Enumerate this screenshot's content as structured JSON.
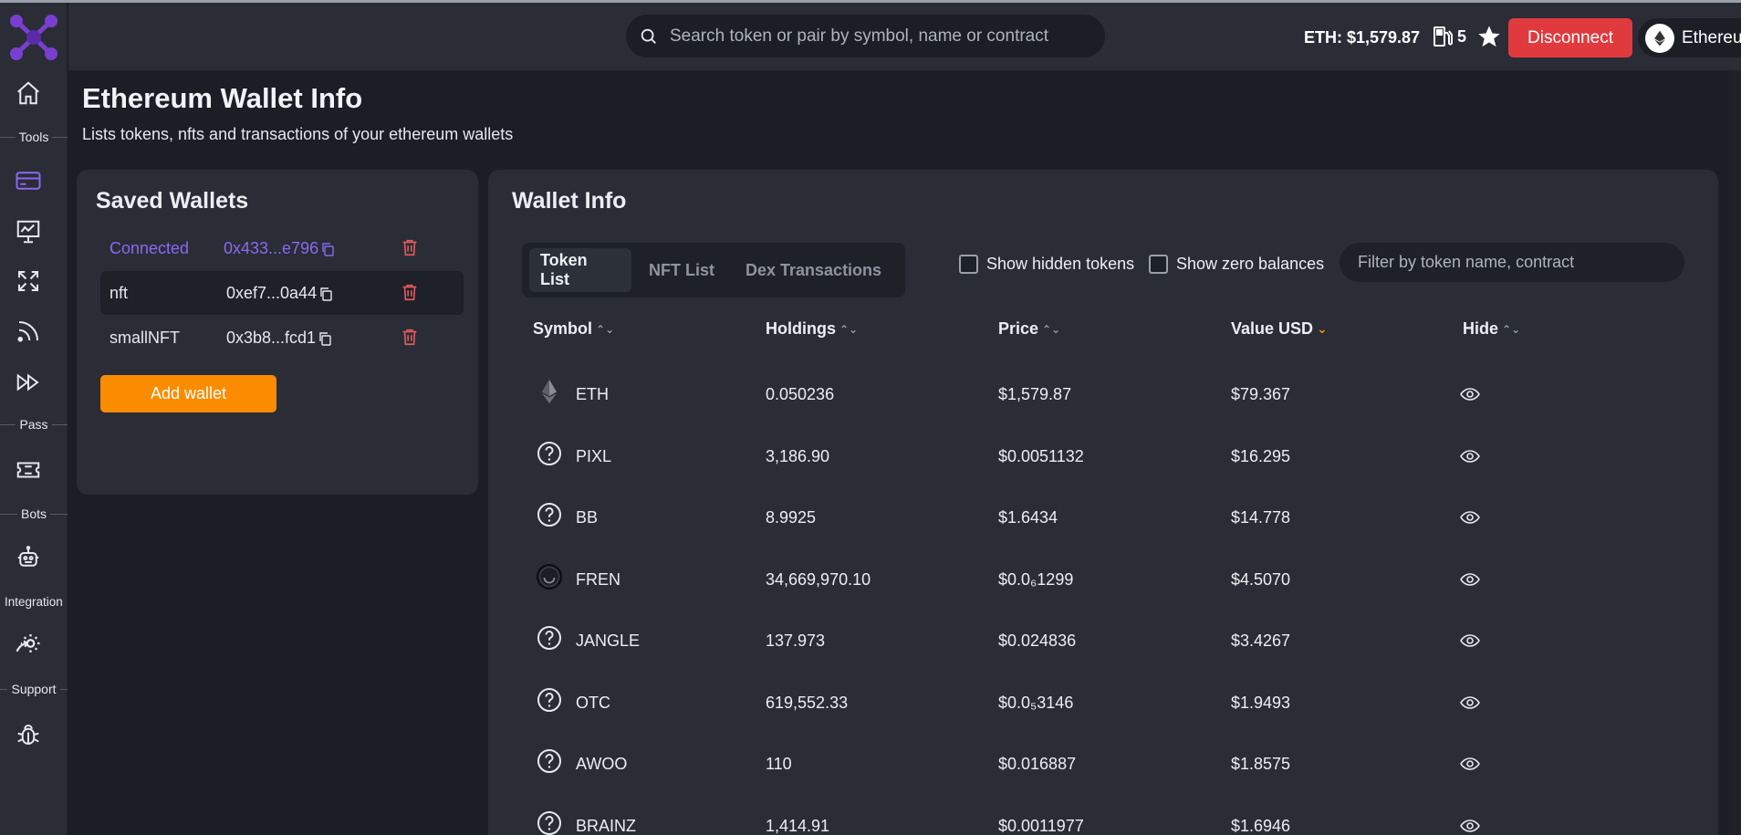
{
  "header": {
    "search_placeholder": "Search token or pair by symbol, name or contract",
    "eth_price": "ETH: $1,579.87",
    "gas": "5",
    "disconnect_label": "Disconnect",
    "network": "Ethereum"
  },
  "sidebar": {
    "sections": {
      "tools": "Tools",
      "pass": "Pass",
      "bots": "Bots",
      "integration": "Integration",
      "support": "Support"
    },
    "icons": [
      "home-icon",
      "wallet-card-icon",
      "presentation-icon",
      "expand-icon",
      "rss-icon",
      "fast-forward-icon",
      "ticket-icon",
      "robot-icon",
      "gear-integration-icon",
      "bug-icon"
    ]
  },
  "page": {
    "title": "Ethereum Wallet Info",
    "subtitle": "Lists tokens, nfts and transactions of your ethereum wallets"
  },
  "saved_wallets": {
    "title": "Saved Wallets",
    "wallets": [
      {
        "name": "Connected",
        "address": "0x433...e796"
      },
      {
        "name": "nft",
        "address": "0xef7...0a44"
      },
      {
        "name": "smallNFT",
        "address": "0x3b8...fcd1"
      }
    ],
    "add_label": "Add wallet"
  },
  "wallet_info": {
    "title": "Wallet Info",
    "tabs": [
      "Token List",
      "NFT List",
      "Dex Transactions"
    ],
    "show_hidden": "Show hidden tokens",
    "show_zero": "Show zero balances",
    "filter_placeholder": "Filter by token name, contract",
    "columns": [
      "Symbol",
      "Holdings",
      "Price",
      "Value USD",
      "Hide"
    ],
    "rows": [
      {
        "symbol": "ETH",
        "holdings": "0.050236",
        "price": "$1,579.87",
        "value": "$79.367",
        "icon": "eth-icon"
      },
      {
        "symbol": "PIXL",
        "holdings": "3,186.90",
        "price": "$0.0051132",
        "value": "$16.295",
        "icon": "question-icon"
      },
      {
        "symbol": "BB",
        "holdings": "8.9925",
        "price": "$1.6434",
        "value": "$14.778",
        "icon": "question-icon"
      },
      {
        "symbol": "FREN",
        "holdings": "34,669,970.10",
        "price": "$0.0₆1299",
        "value": "$4.5070",
        "icon": "smiley-icon"
      },
      {
        "symbol": "JANGLE",
        "holdings": "137.973",
        "price": "$0.024836",
        "value": "$3.4267",
        "icon": "question-icon"
      },
      {
        "symbol": "OTC",
        "holdings": "619,552.33",
        "price": "$0.0₅3146",
        "value": "$1.9493",
        "icon": "question-icon"
      },
      {
        "symbol": "AWOO",
        "holdings": "110",
        "price": "$0.016887",
        "value": "$1.8575",
        "icon": "question-icon"
      },
      {
        "symbol": "BRAINZ",
        "holdings": "1,414.91",
        "price": "$0.0011977",
        "value": "$1.6946",
        "icon": "question-icon"
      }
    ]
  },
  "colors": {
    "accent_purple": "#8b68f2",
    "accent_orange": "#fb8c00",
    "danger_red": "#e03a3e"
  }
}
